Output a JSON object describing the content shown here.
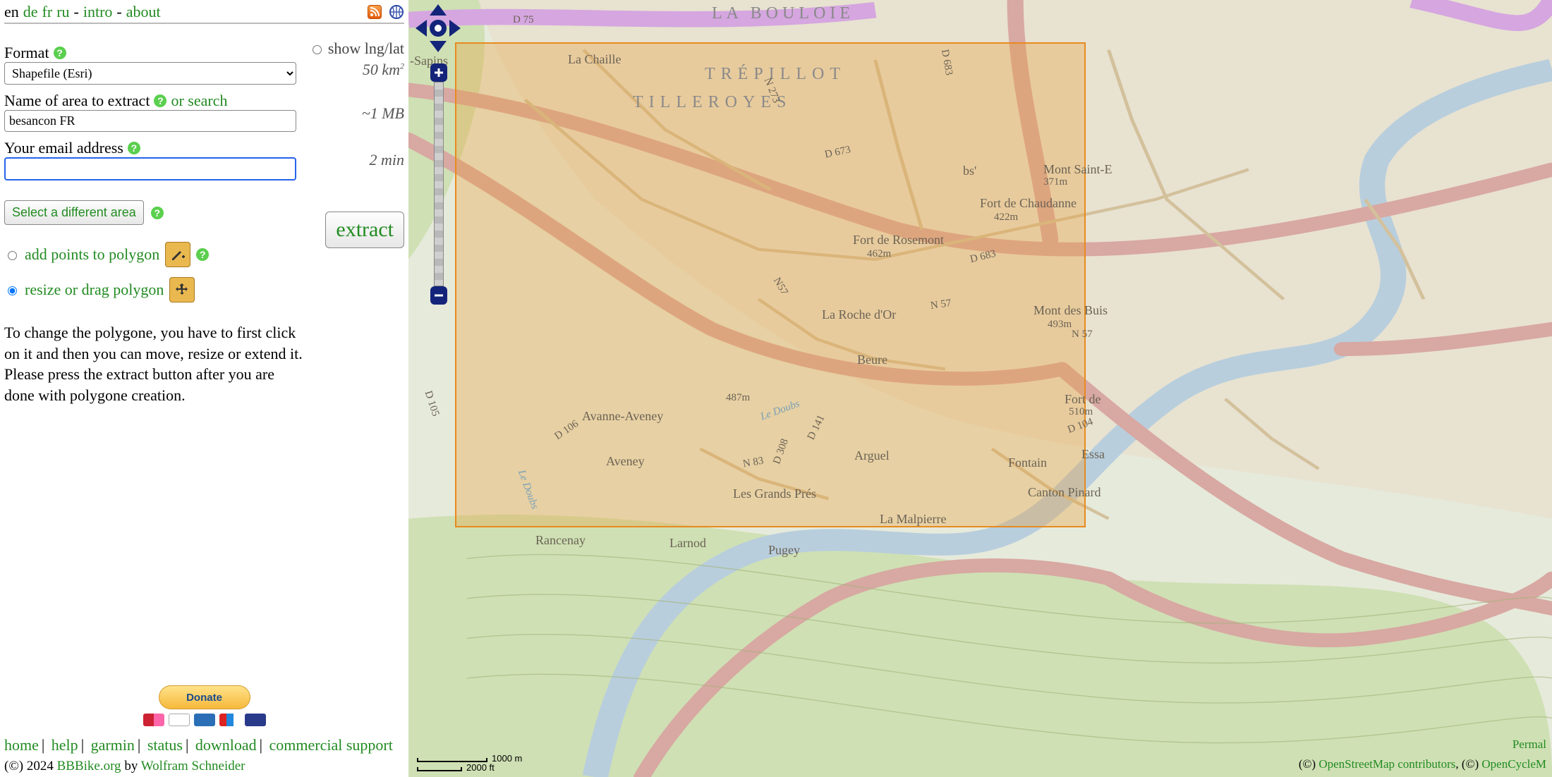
{
  "topbar": {
    "lang_current": "en",
    "lang_de": "de",
    "lang_fr": "fr",
    "lang_ru": "ru",
    "sep": "-",
    "intro": "intro",
    "about": "about"
  },
  "form": {
    "format_label": "Format",
    "format_value": "Shapefile (Esri)",
    "area_label": "Name of area to extract",
    "or_search": "or search",
    "area_value": "besancon FR",
    "email_label": "Your email address",
    "email_value": "",
    "show_lnglat_label": "show lng/lat",
    "area_km_prefix": "50 km",
    "area_km_sup": "2",
    "size_est": "~1 MB",
    "time_est": "2 min",
    "select_area_btn": "Select a different area",
    "extract_btn": "extract"
  },
  "polygon": {
    "add_points": "add points to polygon",
    "resize_drag": "resize or drag polygon",
    "instructions": "To change the polygone, you have to first click on it and then you can move, resize or extend it. Please press the extract button after you are done with polygone creation."
  },
  "donate": {
    "btn_label": "Donate"
  },
  "footer": {
    "home": "home",
    "help": "help",
    "garmin": "garmin",
    "status": "status",
    "download": "download",
    "commercial": "commercial support",
    "copyright_prefix": "(©) 2024 ",
    "bbbike_link": "BBBike.org",
    "by": " by ",
    "author": "Wolfram Schneider"
  },
  "map": {
    "labels": {
      "la_bouloie": "LA BOULOIE",
      "trepillot": "TRÉPILLOT",
      "tilleroyes": "TILLEROYES",
      "la_chaille": "La Chaille",
      "sapins": "-Sapins",
      "bs": "bs'",
      "mont_saint": "Mont Saint-E",
      "mont_saint_elev": "371m",
      "fort_chaudanne": "Fort de Chaudanne",
      "fort_chaudanne_elev": "422m",
      "fort_rosemont": "Fort de Rosemont",
      "fort_rosemont_elev": "462m",
      "la_roche": "La Roche d'Or",
      "mont_buis": "Mont des Buis",
      "mont_buis_elev": "493m",
      "beure": "Beure",
      "elev_487": "487m",
      "le_doubs": "Le Doubs",
      "avanne": "Avanne-Aveney",
      "aveney": "Aveney",
      "arguel": "Arguel",
      "fontain": "Fontain",
      "fort_de": "Fort de",
      "fort_de_elev": "510m",
      "essa": "Essa",
      "canton": "Canton Pinard",
      "grands_pres": "Les Grands Prés",
      "la_malpierre": "La Malpierre",
      "rancenay": "Rancenay",
      "larnod": "Larnod",
      "pugey": "Pugey",
      "le_doubs2": "Le Doubs",
      "d75": "D 75",
      "n273": "N 273",
      "d673": "D 673",
      "d683a": "D 683",
      "d683b": "D 683",
      "n57a": "N57",
      "n57b": "N 57",
      "n57c": "N 57",
      "d105": "D 105",
      "d106": "D 106",
      "d141": "D 141",
      "d308": "D 308",
      "n83": "N 83",
      "d104": "D 104"
    },
    "scale_m": "1000 m",
    "scale_ft": "2000 ft",
    "attrib_osm": "OpenStreetMap contributors",
    "attrib_ocm": "OpenCycleM",
    "attrib_prefix": "(©) ",
    "attrib_sep": ", (©) ",
    "permalink": "Permal"
  }
}
